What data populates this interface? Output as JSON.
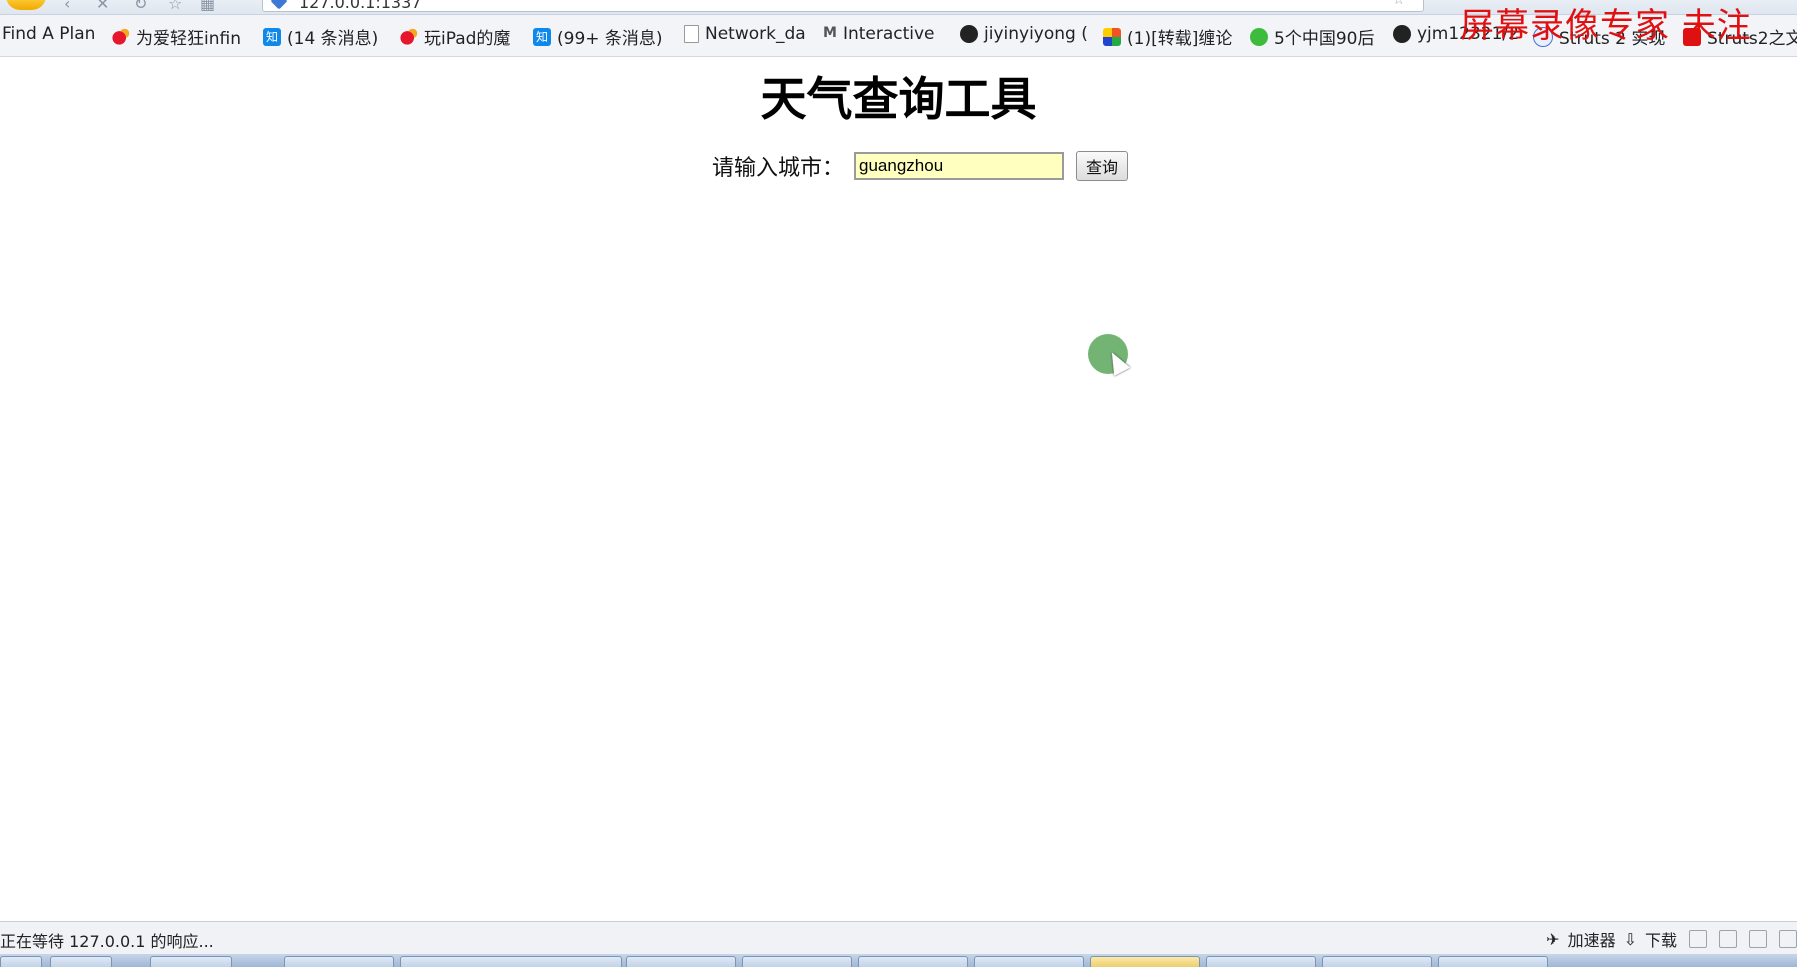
{
  "browser": {
    "address": "127.0.0.1:1337",
    "watermark": "屏幕录像专家 未注"
  },
  "bookmarks": [
    {
      "label": "Find A Plan",
      "icon": "none"
    },
    {
      "label": "为爱轻狂infin",
      "icon": "weibo-icon"
    },
    {
      "label": "(14 条消息)",
      "icon": "zhihu-icon"
    },
    {
      "label": "玩iPad的魔",
      "icon": "weibo-icon"
    },
    {
      "label": "(99+ 条消息)",
      "icon": "zhihu-icon"
    },
    {
      "label": "Network_da",
      "icon": "document-icon"
    },
    {
      "label": "Interactive",
      "icon": "ml-icon"
    },
    {
      "label": "jiyinyiyong (",
      "icon": "github-icon"
    },
    {
      "label": "(1)[转载]缠论",
      "icon": "mosaic-icon"
    },
    {
      "label": "5个中国90后",
      "icon": "wechat-icon"
    },
    {
      "label": "yjm12321/2",
      "icon": "github-icon"
    },
    {
      "label": "Struts 2 实现",
      "icon": "struts-icon"
    },
    {
      "label": "Struts2之文",
      "icon": "struts2-icon"
    }
  ],
  "page": {
    "title": "天气查询工具",
    "city_label": "请输入城市：",
    "city_value": "guangzhou",
    "query_button": "查询"
  },
  "status": {
    "text": "正在等待 127.0.0.1 的响应...",
    "accelerator": "加速器",
    "download": "下载"
  }
}
